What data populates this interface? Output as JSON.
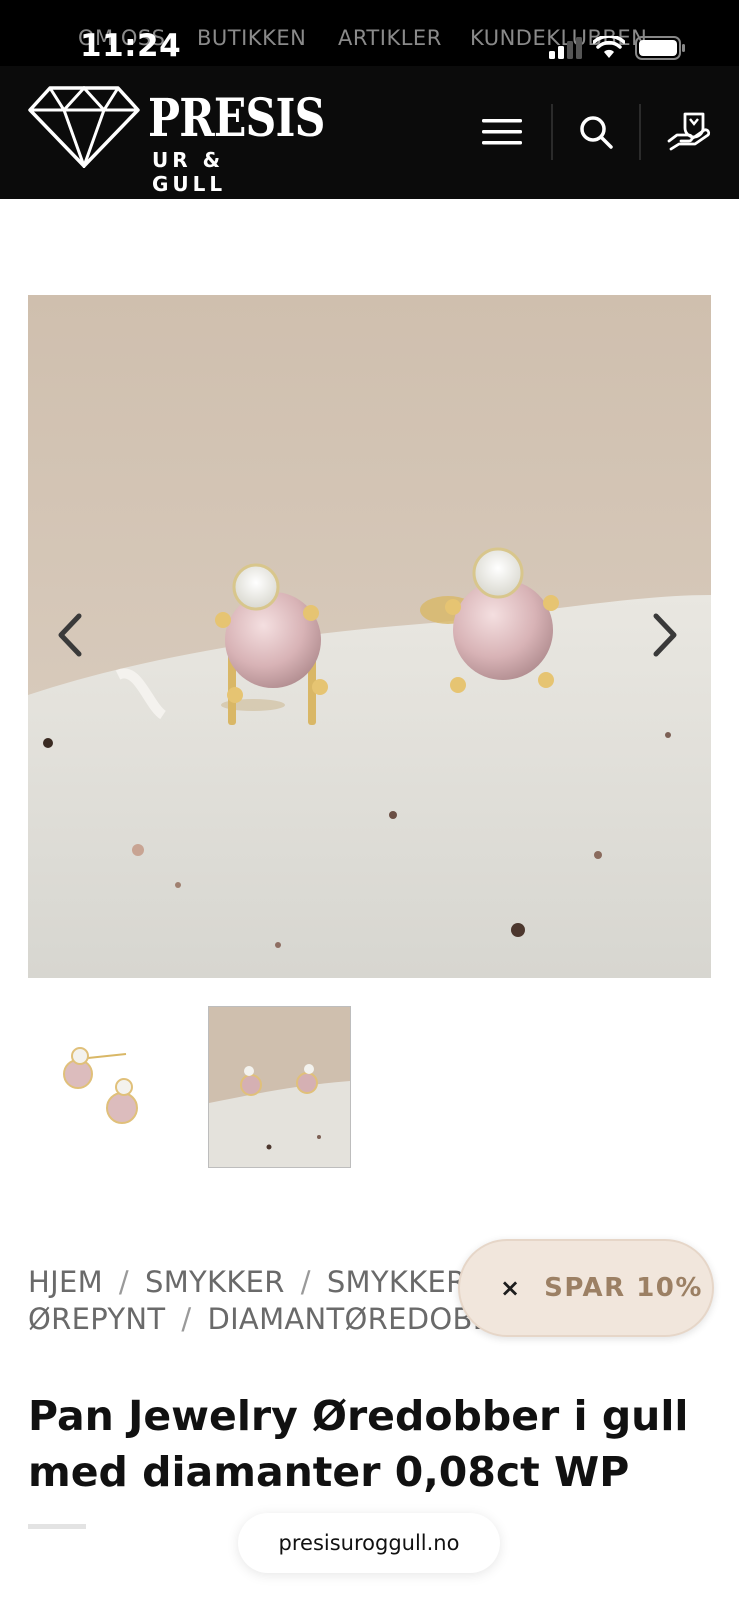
{
  "status_bar": {
    "time": "11:24"
  },
  "top_nav": {
    "items": [
      "OM OSS",
      "BUTIKKEN",
      "ARTIKLER",
      "KUNDEKLUBBEN"
    ]
  },
  "header": {
    "brand_name": "PRESIS",
    "brand_tagline": "UR & GULL",
    "icons": [
      "menu-icon",
      "search-icon",
      "account-icon"
    ]
  },
  "gallery": {
    "images_count": 2,
    "active_thumb": 1
  },
  "breadcrumb": {
    "items": [
      "HJEM",
      "SMYKKER",
      "SMYKKER",
      "ØREPYNT",
      "DIAMANTØREDOBBER"
    ],
    "separator": "/"
  },
  "promo": {
    "close": "×",
    "label": "SPAR 10%"
  },
  "product": {
    "title": "Pan Jewelry Øredobber i gull med diamanter 0,08ct WP"
  },
  "browser": {
    "url": "presisuroggull.no"
  },
  "colors": {
    "header_bg": "#0b0b0b",
    "promo_bg": "#f1e6dc",
    "promo_text": "#9c8064"
  }
}
